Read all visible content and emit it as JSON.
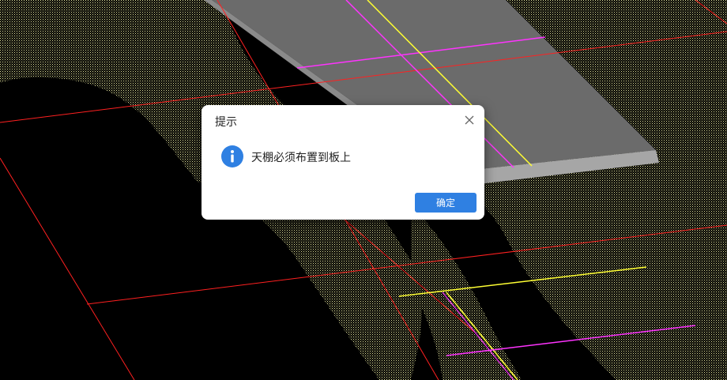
{
  "dialog": {
    "title": "提示",
    "message": "天棚必须布置到板上",
    "ok_label": "确定",
    "icon": "info-icon",
    "close_icon": "close-icon"
  },
  "colors": {
    "background": "#000000",
    "grid_line": "#ff0000",
    "hatch": "#e8e8a0",
    "slab": "#6b6b6b",
    "axis_magenta": "#ff33ff",
    "axis_yellow": "#ffff33",
    "button": "#2f80e2"
  }
}
